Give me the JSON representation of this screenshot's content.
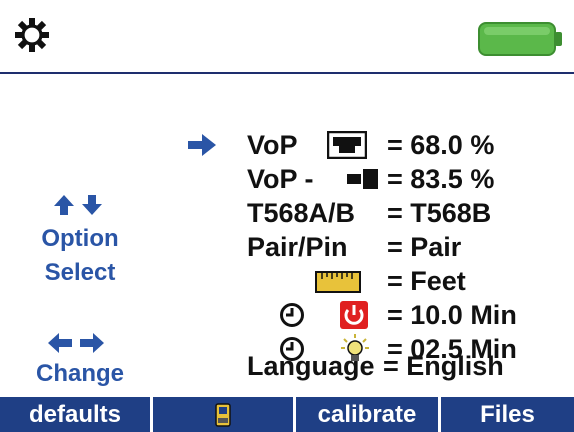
{
  "header": {
    "settings_icon": "gear-icon",
    "battery_icon": "battery-full-icon",
    "battery_color": "#5bb84a",
    "divider_color": "#1e2e6e"
  },
  "left_panel": {
    "option_label": "Option",
    "select_label": "Select",
    "change_label": "Change",
    "up_down_icon": "up-down-arrows-icon",
    "left_right_icon": "left-right-arrows-icon",
    "accent_color": "#2a55a6"
  },
  "settings": {
    "selected_row": 0,
    "rows": [
      {
        "label": "VoP",
        "icon": "rj45-port-icon",
        "value": "= 68.0 %"
      },
      {
        "label": "VoP -",
        "icon": "cable-plug-icon",
        "value": "= 83.5 %"
      },
      {
        "label": "T568A/B",
        "value": "= T568B"
      },
      {
        "label": "Pair/Pin",
        "value": "= Pair"
      },
      {
        "label": "",
        "icon": "ruler-icon",
        "value": "= Feet"
      },
      {
        "label": "",
        "icon": "clock-power-icon",
        "value": "= 10.0 Min"
      },
      {
        "label": "",
        "icon": "clock-backlight-icon",
        "value": "= 02.5 Min"
      },
      {
        "label": "Language",
        "value": "= English"
      }
    ]
  },
  "footer": {
    "defaults_label": "defaults",
    "save_icon": "handheld-device-icon",
    "calibrate_label": "calibrate",
    "files_label": "Files",
    "bar_color": "#1f3f85"
  }
}
